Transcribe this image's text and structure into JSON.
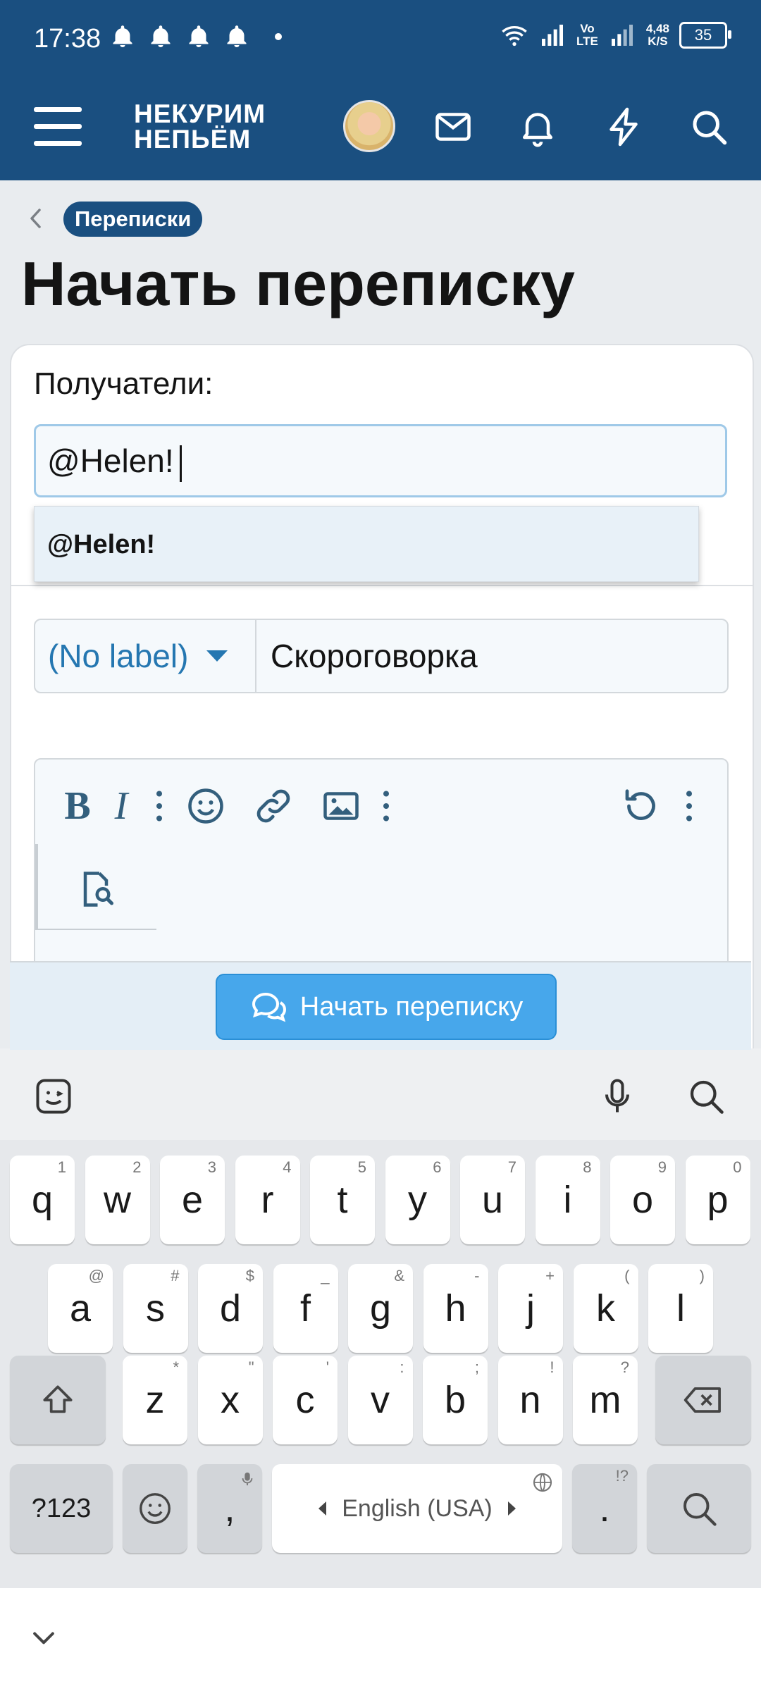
{
  "status_bar": {
    "time": "17:38",
    "network_volte": "Vo\nLTE",
    "net_speed_value": "4,48",
    "net_speed_unit": "K/S",
    "battery": "35"
  },
  "header": {
    "logo_line1": "НЕКУРИМ",
    "logo_line2": "НЕПЬЁМ"
  },
  "breadcrumb": {
    "label": "Переписки"
  },
  "page": {
    "title": "Начать переписку"
  },
  "form": {
    "recipients_label": "Получатели:",
    "recipients_value": "@Helen!",
    "suggestion": "@Helen!",
    "prefix_value": "(No label)",
    "title_value": "Скороговорка"
  },
  "editor_toolbar": {
    "bold": "B",
    "italic": "I"
  },
  "submit": {
    "label": "Начать переписку"
  },
  "keyboard": {
    "row1": [
      {
        "key": "q",
        "hint": "1"
      },
      {
        "key": "w",
        "hint": "2"
      },
      {
        "key": "e",
        "hint": "3"
      },
      {
        "key": "r",
        "hint": "4"
      },
      {
        "key": "t",
        "hint": "5"
      },
      {
        "key": "y",
        "hint": "6"
      },
      {
        "key": "u",
        "hint": "7"
      },
      {
        "key": "i",
        "hint": "8"
      },
      {
        "key": "o",
        "hint": "9"
      },
      {
        "key": "p",
        "hint": "0"
      }
    ],
    "row2": [
      {
        "key": "a",
        "hint": "@"
      },
      {
        "key": "s",
        "hint": "#"
      },
      {
        "key": "d",
        "hint": "$"
      },
      {
        "key": "f",
        "hint": "_"
      },
      {
        "key": "g",
        "hint": "&"
      },
      {
        "key": "h",
        "hint": "-"
      },
      {
        "key": "j",
        "hint": "+"
      },
      {
        "key": "k",
        "hint": "("
      },
      {
        "key": "l",
        "hint": ")"
      }
    ],
    "row3": [
      {
        "key": "z",
        "hint": "*"
      },
      {
        "key": "x",
        "hint": "\""
      },
      {
        "key": "c",
        "hint": "'"
      },
      {
        "key": "v",
        "hint": ":"
      },
      {
        "key": "b",
        "hint": ";"
      },
      {
        "key": "n",
        "hint": "!"
      },
      {
        "key": "m",
        "hint": "?"
      }
    ],
    "symbols_key": "?123",
    "comma_key": ",",
    "space_label": "English (USA)",
    "period_key": ".",
    "period_hint": "!?"
  }
}
